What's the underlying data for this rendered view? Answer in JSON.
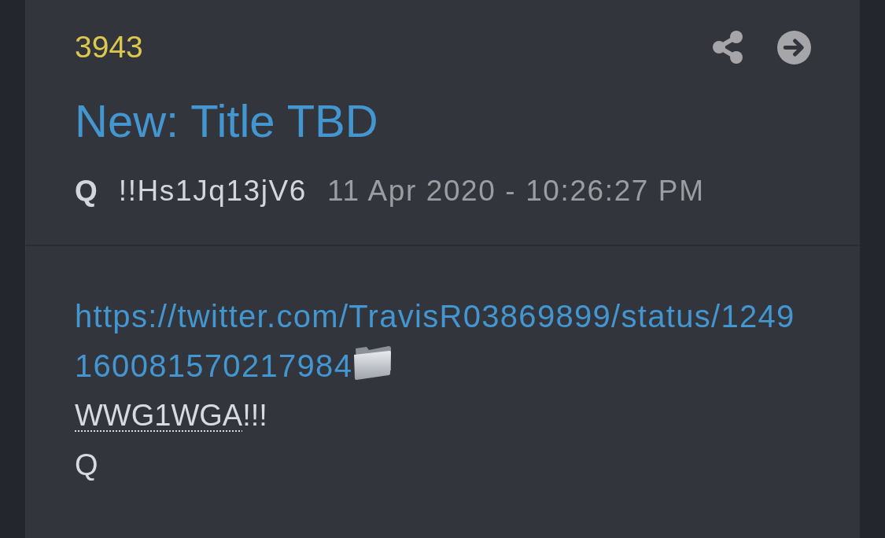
{
  "post": {
    "number": "3943",
    "title": "New: Title TBD",
    "author": "Q",
    "tripcode": "!!Hs1Jq13jV6",
    "date": "11 Apr 2020 - 10:26:27 PM"
  },
  "body": {
    "lines": [
      {
        "kind": "link",
        "text": "https://twitter.com/TravisR03869899/status/1249160081570217984"
      },
      {
        "kind": "text",
        "parts": [
          {
            "text": "WWG1WGA",
            "abbr": true
          },
          {
            "text": "!!!",
            "abbr": false
          }
        ]
      },
      {
        "kind": "text",
        "parts": [
          {
            "text": "Q",
            "abbr": false
          }
        ]
      }
    ]
  }
}
